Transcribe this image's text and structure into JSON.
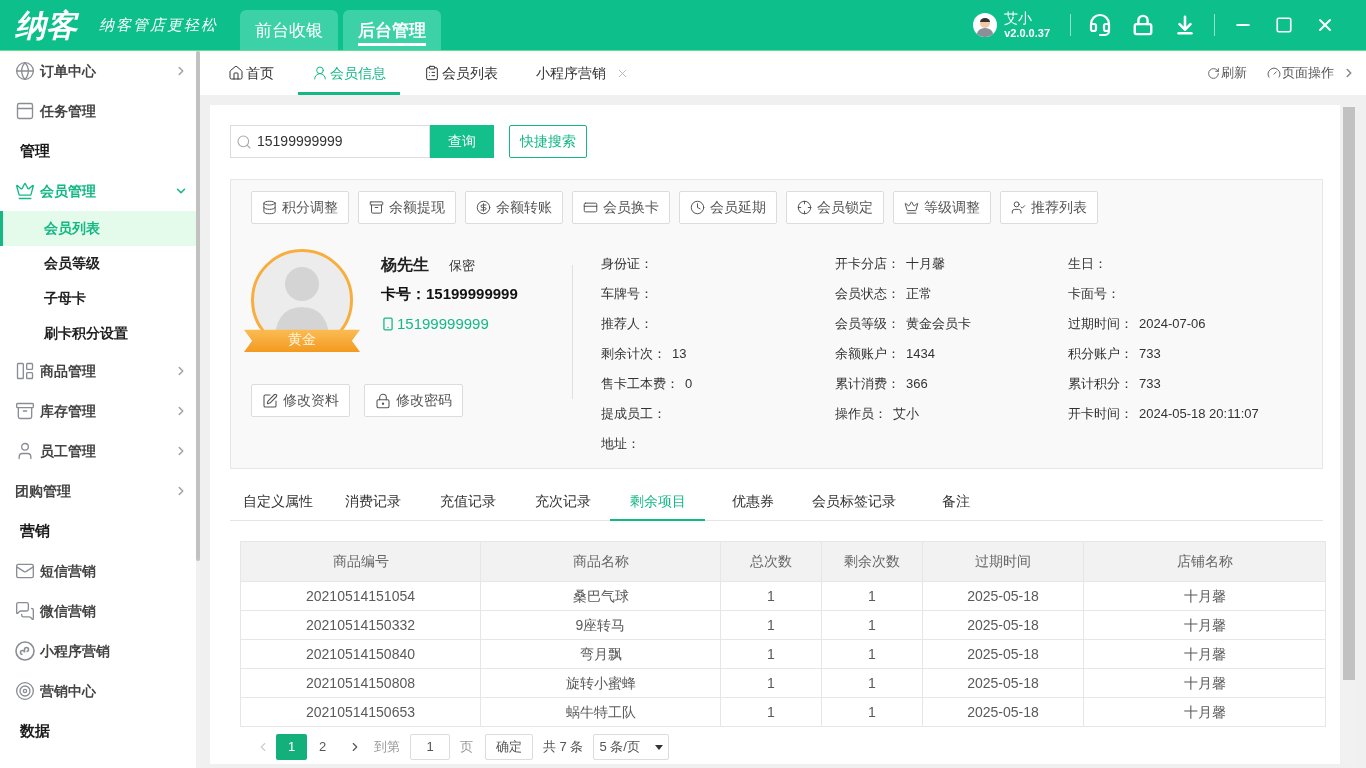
{
  "header": {
    "logo": "纳客",
    "slogan": "纳客管店更轻松",
    "tabs": [
      {
        "label": "前台收银",
        "selected": false
      },
      {
        "label": "后台管理",
        "selected": true
      }
    ],
    "user": {
      "name": "艾小",
      "version": "v2.0.0.37"
    }
  },
  "sidebar": {
    "items": [
      {
        "kind": "group",
        "label": "订单中心",
        "expanded": false
      },
      {
        "kind": "item",
        "label": "任务管理"
      },
      {
        "kind": "section",
        "label": "管理"
      },
      {
        "kind": "group",
        "label": "会员管理",
        "expanded": true,
        "children": [
          {
            "label": "会员列表",
            "selected": true
          },
          {
            "label": "会员等级",
            "selected": false
          },
          {
            "label": "子母卡",
            "selected": false
          },
          {
            "label": "刷卡积分设置",
            "selected": false
          }
        ]
      },
      {
        "kind": "group",
        "label": "商品管理",
        "expanded": false
      },
      {
        "kind": "group",
        "label": "库存管理",
        "expanded": false
      },
      {
        "kind": "group",
        "label": "员工管理",
        "expanded": false
      },
      {
        "kind": "group",
        "label": "团购管理",
        "expanded": false
      },
      {
        "kind": "section",
        "label": "营销"
      },
      {
        "kind": "item",
        "label": "短信营销"
      },
      {
        "kind": "item",
        "label": "微信营销"
      },
      {
        "kind": "item",
        "label": "小程序营销"
      },
      {
        "kind": "item",
        "label": "营销中心"
      },
      {
        "kind": "section",
        "label": "数据"
      }
    ]
  },
  "page_tabs": {
    "tabs": [
      {
        "label": "首页",
        "selected": false,
        "closable": false
      },
      {
        "label": "会员信息",
        "selected": true,
        "closable": false
      },
      {
        "label": "会员列表",
        "selected": false,
        "closable": false
      },
      {
        "label": "小程序营销",
        "selected": false,
        "closable": true
      }
    ],
    "actions": [
      "刷新",
      "页面操作"
    ]
  },
  "search": {
    "value": "15199999999",
    "button": "查询",
    "quick_search": "快捷搜索"
  },
  "member_actions": [
    "积分调整",
    "余额提现",
    "余额转账",
    "会员换卡",
    "会员延期",
    "会员锁定",
    "等级调整",
    "推荐列表"
  ],
  "member": {
    "name": "杨先生",
    "gender": "保密",
    "card_label": "卡号：",
    "card_number": "15199999999",
    "phone": "15199999999",
    "level_badge": "黄金",
    "buttons": [
      "修改资料",
      "修改密码"
    ],
    "info_columns": [
      [
        {
          "label": "身份证："
        },
        {
          "label": "车牌号："
        },
        {
          "label": "推荐人："
        },
        {
          "label": "剩余计次：",
          "value": "13"
        },
        {
          "label": "售卡工本费：",
          "value": "0"
        },
        {
          "label": "提成员工："
        },
        {
          "label": "地址："
        }
      ],
      [
        {
          "label": "开卡分店：",
          "value": "十月馨"
        },
        {
          "label": "会员状态：",
          "value": "正常"
        },
        {
          "label": "会员等级：",
          "value": "黄金会员卡"
        },
        {
          "label": "余额账户：",
          "value": "1434"
        },
        {
          "label": "累计消费：",
          "value": "366"
        },
        {
          "label": "操作员：",
          "value": "艾小"
        }
      ],
      [
        {
          "label": "生日："
        },
        {
          "label": "卡面号："
        },
        {
          "label": "过期时间：",
          "value": "2024-07-06"
        },
        {
          "label": "积分账户：",
          "value": "733"
        },
        {
          "label": "累计积分：",
          "value": "733"
        },
        {
          "label": "开卡时间：",
          "value": "2024-05-18 20:11:07"
        }
      ]
    ]
  },
  "detail_tabs": [
    {
      "label": "自定义属性",
      "selected": false
    },
    {
      "label": "消费记录",
      "selected": false
    },
    {
      "label": "充值记录",
      "selected": false
    },
    {
      "label": "充次记录",
      "selected": false
    },
    {
      "label": "剩余项目",
      "selected": true
    },
    {
      "label": "优惠券",
      "selected": false
    },
    {
      "label": "会员标签记录",
      "selected": false
    },
    {
      "label": "备注",
      "selected": false
    }
  ],
  "table": {
    "columns": [
      "商品编号",
      "商品名称",
      "总次数",
      "剩余次数",
      "过期时间",
      "店铺名称"
    ],
    "rows": [
      [
        "20210514151054",
        "桑巴气球",
        "1",
        "1",
        "2025-05-18",
        "十月馨"
      ],
      [
        "20210514150332",
        "9座转马",
        "1",
        "1",
        "2025-05-18",
        "十月馨"
      ],
      [
        "20210514150840",
        "弯月飘",
        "1",
        "1",
        "2025-05-18",
        "十月馨"
      ],
      [
        "20210514150808",
        "旋转小蜜蜂",
        "1",
        "1",
        "2025-05-18",
        "十月馨"
      ],
      [
        "20210514150653",
        "蜗牛特工队",
        "1",
        "1",
        "2025-05-18",
        "十月馨"
      ]
    ]
  },
  "pagination": {
    "prev_disabled": true,
    "pages": [
      {
        "label": "1",
        "selected": true
      },
      {
        "label": "2",
        "selected": false
      }
    ],
    "next_disabled": false,
    "goto_label": "到第",
    "goto_value": "1",
    "page_unit": "页",
    "confirm": "确定",
    "total": "共 7 条",
    "page_size": "5 条/页"
  }
}
